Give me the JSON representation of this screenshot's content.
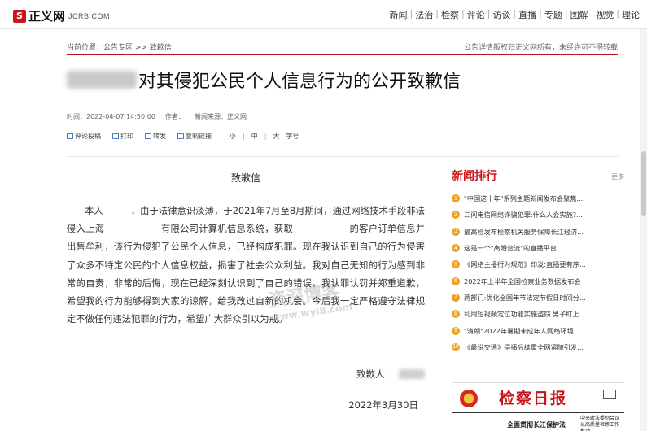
{
  "header": {
    "logo_icon": "S",
    "logo_cn": "正义网",
    "logo_en": "JCRB.COM",
    "nav": [
      "新闻",
      "法治",
      "检察",
      "评论",
      "访谈",
      "直播",
      "专题",
      "图解",
      "视觉",
      "理论"
    ]
  },
  "breadcrumb": {
    "text": "当前位置：公告专区 >> 致歉信",
    "copyright": "公告详情版权归正义网所有，未经许可不得转载"
  },
  "article": {
    "title": "对其侵犯公民个人信息行为的公开致歉信",
    "time": "时间：2022-04-07 14:50:00",
    "author": "作者：",
    "source": "新闻来源：正义网",
    "tools": [
      "评论投稿",
      "打印",
      "转发",
      "复制链接"
    ],
    "font_sizes": [
      "小",
      "中",
      "大"
    ],
    "font_label": "字号",
    "letter_title": "致歉信",
    "body": "本人　　　，由于法律意识淡薄，于2021年7月至8月期间，通过网络技术手段非法侵入上海　　　　　　有限公司计算机信息系统，获取　　　　　　的客户订单信息并出售牟利，该行为侵犯了公民个人信息，已经构成犯罪。现在我认识到自己的行为侵害了众多不特定公民的个人信息权益，损害了社会公众利益。我对自己无知的行为感到非常的自责，非常的后悔，现在已经深刻认识到了自己的错误。我认罪认罚并郑重道歉，希望我的行为能够得到大家的谅解，给我改过自新的机会。今后我一定严格遵守法律规定不做任何违法犯罪的行为，希望广大群众引以为戒。",
    "signer_label": "致歉人：",
    "date": "2022年3月30日"
  },
  "sidebar": {
    "title": "新闻排行",
    "more": "更多",
    "items": [
      "\"中国这十年\"系列主题新闻发布会聚焦...",
      "三问电信网络诈骗犯罪:什么人会实施?...",
      "最高检发布检察机关服务保障长江经济...",
      "这是一个\"离婚合流\"的直播平台",
      "《网络主播行为规范》印发:直播要有序...",
      "2022年上半年全国检察业务数据发布会",
      "两部门:优化全国年节法定节假日时间分...",
      "利用短视频定位功能实施盗窃 男子盯上...",
      "\"清朗\"2022年暑期未成年人网络环境...",
      "《最说交通》得播后续重全网紧随引发..."
    ]
  },
  "ad": {
    "paper_name": "检察日报",
    "headline": "全面贯彻长江保护法",
    "right_text": "中央政法委制会议  以高质量检察工作推动..."
  },
  "watermark": {
    "main": "资深博客",
    "sub": "www.wyi8.com"
  },
  "colors": {
    "accent": "#c8161d",
    "rank_badge": "#f0a11b"
  }
}
